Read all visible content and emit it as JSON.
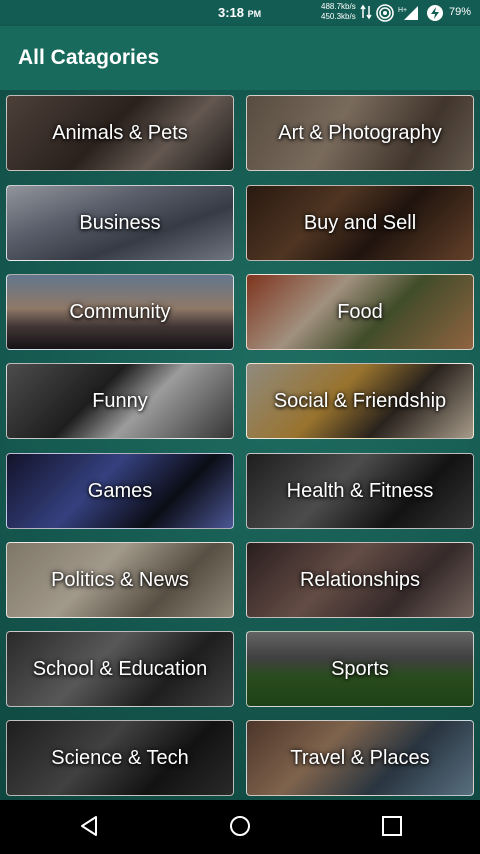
{
  "status_bar": {
    "time": "3:18",
    "ampm": "PM",
    "net_up": "488.7kb/s",
    "net_down": "450.3kb/s",
    "battery": "79%"
  },
  "app_bar": {
    "title": "All Catagories"
  },
  "categories": [
    {
      "label": "Animals & Pets",
      "icon": "animals-photo"
    },
    {
      "label": "Art & Photography",
      "icon": "camera-photo"
    },
    {
      "label": "Business",
      "icon": "buildings-photo"
    },
    {
      "label": "Buy and Sell",
      "icon": "market-photo"
    },
    {
      "label": "Community",
      "icon": "sunset-crowd-photo"
    },
    {
      "label": "Food",
      "icon": "food-photo"
    },
    {
      "label": "Funny",
      "icon": "cat-photo"
    },
    {
      "label": "Social & Friendship",
      "icon": "friends-photo"
    },
    {
      "label": "Games",
      "icon": "controller-photo"
    },
    {
      "label": "Health & Fitness",
      "icon": "fitness-photo"
    },
    {
      "label": "Politics & News",
      "icon": "newspaper-photo"
    },
    {
      "label": "Relationships",
      "icon": "couple-photo"
    },
    {
      "label": "School & Education",
      "icon": "classroom-photo"
    },
    {
      "label": "Sports",
      "icon": "stadium-photo"
    },
    {
      "label": "Science & Tech",
      "icon": "tech-photo"
    },
    {
      "label": "Travel & Places",
      "icon": "coast-town-photo"
    }
  ],
  "nav_bar": {
    "back": "back-icon",
    "home": "home-icon",
    "recents": "recents-icon"
  }
}
